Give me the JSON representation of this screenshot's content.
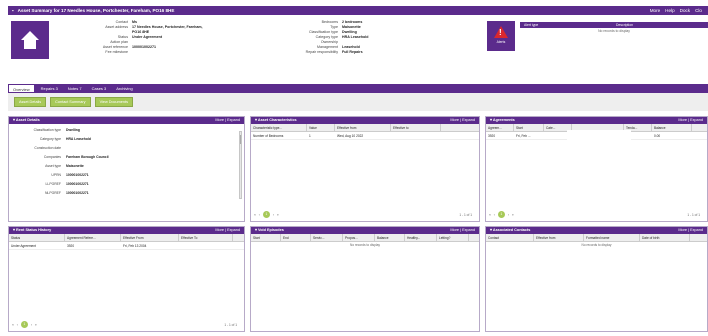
{
  "title": "Asset Summary for 17 Needles House, Portchester, Fareham, PO16 8HE",
  "top_links": [
    "More",
    "Help",
    "Dock",
    "Clo"
  ],
  "details_header": {
    "left": [
      {
        "k": "Contact",
        "v": "Ms"
      },
      {
        "k": "Asset address",
        "v": "17 Needles House, Portchester, Fareham, PO16 8HE"
      },
      {
        "k": "Status",
        "v": "Under Agreement"
      },
      {
        "k": "Action plan",
        "v": ""
      },
      {
        "k": "Asset reference",
        "v": "100001002271"
      },
      {
        "k": "Fee milestone",
        "v": ""
      }
    ],
    "right": [
      {
        "k": "Bedrooms",
        "v": "2 bedrooms"
      },
      {
        "k": "Type",
        "v": "Maisonette"
      },
      {
        "k": "Classification type",
        "v": "Dwelling"
      },
      {
        "k": "Category type",
        "v": "HRA Leasehold"
      },
      {
        "k": "Ownership",
        "v": ""
      },
      {
        "k": "Management",
        "v": "Leasehold"
      },
      {
        "k": "Repair responsibility",
        "v": "Full Repairs"
      }
    ]
  },
  "alerts": {
    "label": "Alerts",
    "col1": "Alert type",
    "col2": "Description",
    "empty": "No records to display"
  },
  "tabs": [
    "Overview",
    "Repairs 3",
    "Notes 7",
    "Cases 3",
    "Archiving"
  ],
  "toolbar": [
    "Asset Details",
    "Contact Summary",
    "View Documents"
  ],
  "asset_details": {
    "title": "Asset Details",
    "tools": "More | Expand",
    "rows": [
      {
        "k": "Classification type",
        "v": "Dwelling"
      },
      {
        "k": "Category type",
        "v": "HRA Leasehold"
      },
      {
        "k": "Construction date",
        "v": ""
      },
      {
        "k": "Companies",
        "v": "Fareham Borough Council"
      },
      {
        "k": "Asset type",
        "v": "Maisonette"
      },
      {
        "k": "UPRN",
        "v": "100001002271"
      },
      {
        "k": "LLPGREF",
        "v": "100001002271"
      },
      {
        "k": "NLPGREF",
        "v": "100001002271"
      }
    ]
  },
  "characteristics": {
    "title": "Asset Characteristics",
    "tools": "More | Expand",
    "cols": [
      "Characteristic type...",
      "Value",
      "Effective from",
      "Effective to"
    ],
    "rows": [
      [
        "Number of Bedrooms",
        "1",
        "Wed, Aug 10 2022",
        ""
      ]
    ],
    "page": "1",
    "count": "1 - 1 of 1"
  },
  "agreements": {
    "title": "Agreements",
    "tools": "More | Expand",
    "cols": [
      "Agreem...",
      "Start",
      "Cate...",
      "",
      "Tenda...",
      "Balance"
    ],
    "rows": [
      [
        "3920",
        "Fri, Feb ...",
        "",
        "Leasehold",
        "",
        "0.00"
      ]
    ],
    "page": "1",
    "count": "1 - 1 of 1"
  },
  "rent_status": {
    "title": "Rent Status History",
    "tools": "More | Expand",
    "cols": [
      "Status",
      "Agreement Refere...",
      "Effective From",
      "Effective To"
    ],
    "rows": [
      [
        "Under Agreement",
        "3920",
        "Fri, Feb 13 2004",
        ""
      ]
    ],
    "page": "1",
    "count": "1 - 1 of 1"
  },
  "void_episodes": {
    "title": "Void Episodes",
    "tools": "More | Expand",
    "cols": [
      "Start",
      "End",
      "Servic...",
      "Propos...",
      "Balance",
      "Healthy...",
      "Letting?"
    ],
    "empty": "No records to display"
  },
  "associated_contacts": {
    "title": "Associated Contacts",
    "tools": "More | Expand",
    "cols": [
      "Contact",
      "Effective from",
      "Formatted name",
      "Date of birth"
    ],
    "empty": "No records to display"
  },
  "colors": {
    "brand": "#5b2b8c",
    "button": "#a7c958",
    "alert": "#d9272e"
  }
}
